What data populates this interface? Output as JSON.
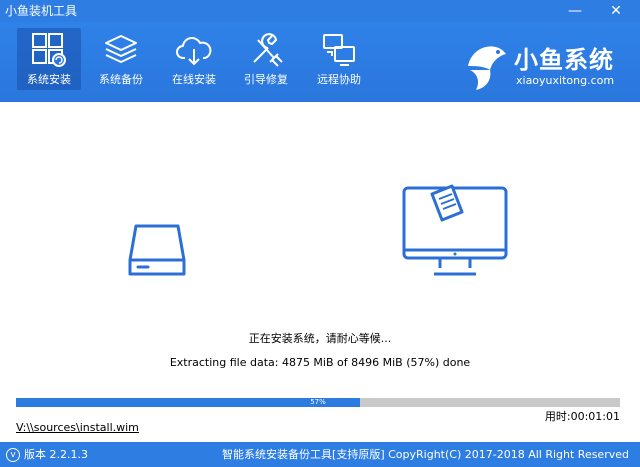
{
  "window": {
    "title": "小鱼装机工具",
    "minimize_glyph": "—",
    "close_glyph": "✕"
  },
  "nav": {
    "items": [
      {
        "label": "系统安装",
        "icon": "windows-restore-icon",
        "active": true
      },
      {
        "label": "系统备份",
        "icon": "layers-icon",
        "active": false
      },
      {
        "label": "在线安装",
        "icon": "cloud-download-icon",
        "active": false
      },
      {
        "label": "引导修复",
        "icon": "wrench-screwdriver-icon",
        "active": false
      },
      {
        "label": "远程协助",
        "icon": "remote-monitors-icon",
        "active": false
      }
    ]
  },
  "brand": {
    "name": "小鱼系统",
    "domain": "xiaoyuxitong.com",
    "logo_icon": "fish-logo-icon"
  },
  "install": {
    "status": "正在安装系统，请耐心等候...",
    "detail": "Extracting file data: 4875 MiB of 8496 MiB (57%) done",
    "progress_percent": 57,
    "progress_label": "57%",
    "elapsed": "用时:00:01:01",
    "file_path": "V:\\\\sources\\install.wim"
  },
  "statusbar": {
    "version": "版本 2.2.1.3",
    "copyright": "智能系统安装备份工具[支持原版]   CopyRight(C) 2017-2018 All Right Reserved"
  },
  "colors": {
    "accent": "#2d7de3",
    "progress_fill": "#2c7be0",
    "progress_track": "#c9c9c9",
    "icon_stroke": "#2b6fd6"
  }
}
